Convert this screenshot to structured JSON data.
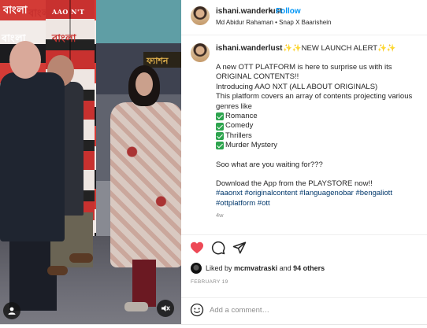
{
  "photo": {
    "overlay_texts": [
      "বাংলা",
      "বাংলা",
      "বাংলা",
      "বাংলা",
      "AAO N'T"
    ],
    "shop_sign": "ফ্যাশন"
  },
  "header": {
    "username": "ishani.wanderlust",
    "separator": "•",
    "follow_label": "Follow",
    "subtitle": "Md Abidur Rahaman • Snap X Baarishein"
  },
  "caption": {
    "username": "ishani.wanderlust",
    "headline": "✨✨NEW LAUNCH ALERT✨✨",
    "paragraph1": "A new OTT PLATFORM is here to surprise us with its ORIGINAL CONTENTS!!\nIntroducing AAO NXT (ALL ABOUT ORIGINALS)\nThis platform covers an array of contents projecting various genres like",
    "genres": [
      "Romance",
      "Comedy",
      "Thrillers",
      "Murder Mystery"
    ],
    "question": "Soo what are you waiting for???",
    "download": "Download the App from the PLAYSTORE now!!",
    "hashtags": "#aaonxt #originalcontent #languagenobar #bengaliott #ottplatform #ott",
    "time_ago": "4w"
  },
  "likes": {
    "prefix": "Liked by",
    "user": "mcmvatraski",
    "conjunction": "and",
    "count": "94 others"
  },
  "date": "FEBRUARY 19",
  "comment": {
    "placeholder": "Add a comment…"
  },
  "colors": {
    "like_red": "#ed4956",
    "follow_blue": "#0095f6",
    "hashtag_blue": "#00376b",
    "check_green": "#2da44e"
  },
  "icons": [
    "user-tag-icon",
    "mute-icon",
    "heart-icon",
    "comment-icon",
    "share-icon",
    "emoji-icon"
  ]
}
